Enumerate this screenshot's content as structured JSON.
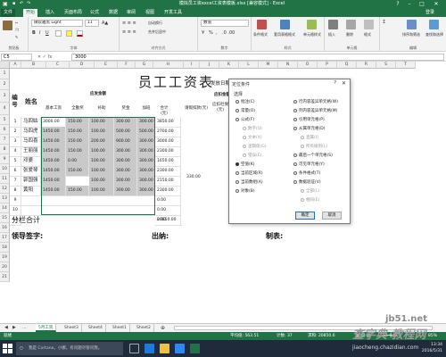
{
  "window": {
    "title": "模拟员工资excel工资表模板.xlsx [兼容模式] - Excel",
    "min": "–",
    "max": "□",
    "close": "✕",
    "help": "?"
  },
  "tabs": [
    "文件",
    "开始",
    "插入",
    "页面布局",
    "公式",
    "数据",
    "审阅",
    "视图",
    "开发工具",
    "登录"
  ],
  "ribbon": {
    "font_name": "微软雅黑 Light",
    "font_size": "11",
    "bold": "B",
    "italic": "I",
    "underline": "U",
    "number_format": "数值",
    "percent": "%",
    "comma": ",",
    "wrap_text": "自动换行",
    "merge_center": "合并后居中",
    "cond_format": "条件格式",
    "table_format": "套用表格格式",
    "cell_style": "单元格样式",
    "insert": "插入",
    "delete": "删除",
    "format": "格式",
    "sort_filter": "排序和筛选",
    "find_select": "查找和选择",
    "groups": [
      "剪贴板",
      "字体",
      "对齐方式",
      "数字",
      "样式",
      "单元格",
      "编辑"
    ]
  },
  "formula": {
    "namebox": "C5",
    "value": "3000",
    "icons": "✕  ✓  fx"
  },
  "columns": [
    "A",
    "B",
    "C",
    "D",
    "E",
    "F",
    "G",
    "H",
    "I",
    "J",
    "K",
    "L",
    "M",
    "N",
    "O",
    "P",
    "Q",
    "R",
    "S",
    "T"
  ],
  "rows": [
    "1",
    "2",
    "3",
    "4",
    "5",
    "6",
    "7",
    "8",
    "9",
    "10",
    "11",
    "12",
    "13",
    "14",
    "15",
    "16",
    "17",
    "18",
    "19",
    "20",
    "21"
  ],
  "sheet": {
    "title": "员工工资表",
    "issue_date": "发放日期",
    "h_no": "编号",
    "h_name": "姓名",
    "h_payable": "应发金额",
    "h_basic": "基本工资",
    "h_allow": "全勤奖",
    "h_sub": "补助",
    "h_bonus": "奖金",
    "h_ot": "加班",
    "h_total": "合计（元）",
    "h_deduct": "应扣金额",
    "h_leave": "请假扣款(元)",
    "h_social": "应扣社保(元)",
    "rows": [
      {
        "no": "1",
        "name": "马四姑",
        "v": [
          "3000.00",
          "150.00",
          "100.00",
          "300.00",
          "300.00",
          "3850.00"
        ]
      },
      {
        "no": "2",
        "name": "马四虎",
        "v": [
          "1450.00",
          "150.00",
          "100.00",
          "500.00",
          "500.00",
          "2700.00"
        ]
      },
      {
        "no": "3",
        "name": "马四喜",
        "v": [
          "1450.00",
          "150.00",
          "200.00",
          "900.00",
          "300.00",
          "3000.00"
        ]
      },
      {
        "no": "4",
        "name": "王丽丽",
        "v": [
          "1450.00",
          "150.00",
          "100.00",
          "300.00",
          "300.00",
          "2300.00"
        ]
      },
      {
        "no": "5",
        "name": "邓婆",
        "v": [
          "1450.00",
          "0.00",
          "100.00",
          "300.00",
          "300.00",
          "1650.00"
        ]
      },
      {
        "no": "6",
        "name": "张爱琴",
        "v": [
          "1450.00",
          "150.00",
          "100.00",
          "300.00",
          "300.00",
          "2300.00"
        ]
      },
      {
        "no": "7",
        "name": "郭国强",
        "v": [
          "1450.00",
          "",
          "100.00",
          "300.00",
          "300.00",
          "2150.00"
        ]
      },
      {
        "no": "8",
        "name": "黄阳",
        "v": [
          "1450.00",
          "150.00",
          "100.00",
          "300.00",
          "300.00",
          "2300.00"
        ]
      },
      {
        "no": "9",
        "name": "",
        "v": [
          "",
          "",
          "",
          "",
          "",
          "0.00"
        ]
      },
      {
        "no": "10",
        "name": "",
        "v": [
          "",
          "",
          "",
          "",
          "",
          "0.00"
        ]
      },
      {
        "no": "11",
        "name": "",
        "v": [
          "",
          "",
          "",
          "",
          "",
          "0.00"
        ]
      }
    ],
    "extra_k": "330.00",
    "subtotal_label": "分栏合计",
    "subtotal_value": "20850.00",
    "sign_leader": "领导签字:",
    "sign_cashier": "出纳:",
    "sign_maker": "制表:"
  },
  "dialog": {
    "title": "定位条件",
    "help": "?",
    "close": "✕",
    "section": "选择",
    "left": [
      {
        "label": "批注(C)",
        "state": "off"
      },
      {
        "label": "常量(O)",
        "state": "off"
      },
      {
        "label": "公式(F)",
        "state": "off"
      },
      {
        "label": "数字(U)",
        "state": "sub"
      },
      {
        "label": "文本(X)",
        "state": "sub"
      },
      {
        "label": "逻辑值(G)",
        "state": "sub"
      },
      {
        "label": "错误(E)",
        "state": "sub"
      },
      {
        "label": "空值(K)",
        "state": "on"
      },
      {
        "label": "当前区域(R)",
        "state": "off"
      },
      {
        "label": "当前数组(A)",
        "state": "off"
      },
      {
        "label": "对象(B)",
        "state": "off"
      }
    ],
    "right": [
      {
        "label": "行内容差异单元格(W)",
        "state": "off"
      },
      {
        "label": "列内容差异单元格(M)",
        "state": "off"
      },
      {
        "label": "引用单元格(P)",
        "state": "off"
      },
      {
        "label": "从属单元格(D)",
        "state": "off"
      },
      {
        "label": "直属(I)",
        "state": "sub"
      },
      {
        "label": "所有级别(L)",
        "state": "sub"
      },
      {
        "label": "最后一个单元格(S)",
        "state": "off"
      },
      {
        "label": "可见单元格(Y)",
        "state": "off"
      },
      {
        "label": "条件格式(T)",
        "state": "off"
      },
      {
        "label": "数据验证(V)",
        "state": "off"
      },
      {
        "label": "全部(L)",
        "state": "sub"
      },
      {
        "label": "相同(E)",
        "state": "sub"
      }
    ],
    "ok": "确定",
    "cancel": "取消"
  },
  "sheet_tabs": [
    "5月工资",
    "Sheet3",
    "Sheet4",
    "Sheet1",
    "Sheet2"
  ],
  "status": {
    "mode": "就绪",
    "avg": "平均值: 563.51",
    "count": "计数: 37",
    "sum": "求和: 20850.6",
    "zoom": "85%"
  },
  "taskbar": {
    "search": "我是 Cortana，小娜。有问题尽管问我。",
    "time": "13:34",
    "date": "2016/5/31"
  },
  "watermark": {
    "site": "jb51.net",
    "brand": "查字典 教程网",
    "url": "jiaocheng.chazidian.com"
  },
  "colors": {
    "excel_green": "#217346",
    "selection_gray": "#c9c9c9",
    "taskbar": "#1f2a3a"
  }
}
